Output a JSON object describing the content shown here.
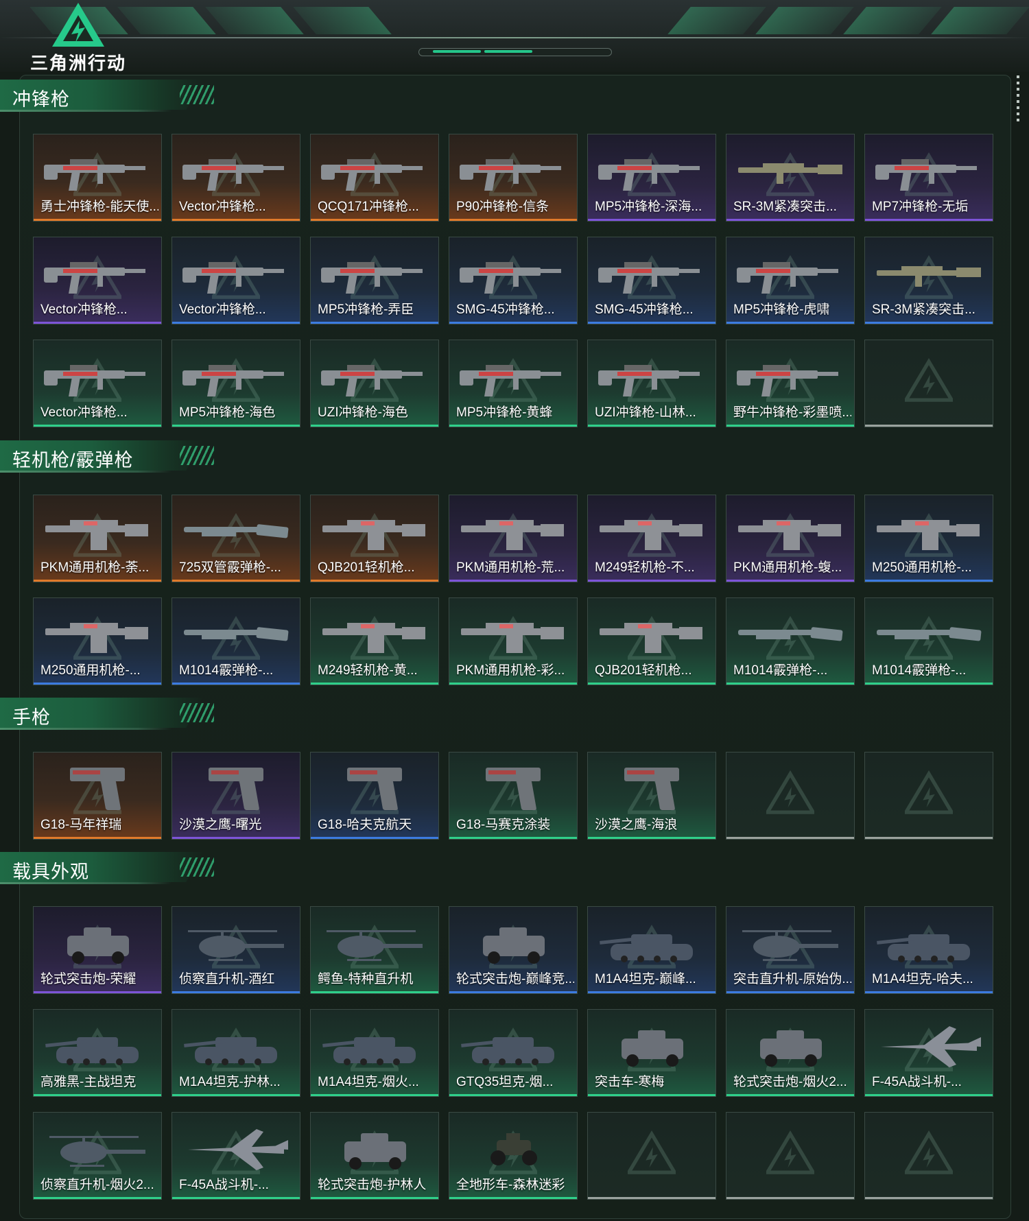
{
  "header": {
    "logo_text": "三角洲行动",
    "accent_color": "#2fd08a"
  },
  "rarity_colors": {
    "orange": "#e07a2a",
    "purple": "#7d54d8",
    "blue": "#3c7be0",
    "green": "#2fd08a",
    "empty": "#9aa29e"
  },
  "sections": [
    {
      "title": "冲锋枪",
      "items": [
        {
          "label": "勇士冲锋枪-能天使...",
          "rarity": "orange",
          "icon": "smg-icon"
        },
        {
          "label": "Vector冲锋枪...",
          "rarity": "orange",
          "icon": "smg-icon"
        },
        {
          "label": "QCQ171冲锋枪...",
          "rarity": "orange",
          "icon": "smg-icon"
        },
        {
          "label": "P90冲锋枪-信条",
          "rarity": "orange",
          "icon": "smg-icon"
        },
        {
          "label": "MP5冲锋枪-深海...",
          "rarity": "purple",
          "icon": "smg-icon"
        },
        {
          "label": "SR-3M紧凑突击...",
          "rarity": "purple",
          "icon": "rifle-icon"
        },
        {
          "label": "MP7冲锋枪-无垢",
          "rarity": "purple",
          "icon": "smg-icon"
        },
        {
          "label": "Vector冲锋枪...",
          "rarity": "purple",
          "icon": "smg-icon"
        },
        {
          "label": "Vector冲锋枪...",
          "rarity": "blue",
          "icon": "smg-icon"
        },
        {
          "label": "MP5冲锋枪-弄臣",
          "rarity": "blue",
          "icon": "smg-icon"
        },
        {
          "label": "SMG-45冲锋枪...",
          "rarity": "blue",
          "icon": "smg-icon"
        },
        {
          "label": "SMG-45冲锋枪...",
          "rarity": "blue",
          "icon": "smg-icon"
        },
        {
          "label": "MP5冲锋枪-虎啸",
          "rarity": "blue",
          "icon": "smg-icon"
        },
        {
          "label": "SR-3M紧凑突击...",
          "rarity": "blue",
          "icon": "rifle-icon"
        },
        {
          "label": "Vector冲锋枪...",
          "rarity": "green",
          "icon": "smg-icon"
        },
        {
          "label": "MP5冲锋枪-海色",
          "rarity": "green",
          "icon": "smg-icon"
        },
        {
          "label": "UZI冲锋枪-海色",
          "rarity": "green",
          "icon": "smg-icon"
        },
        {
          "label": "MP5冲锋枪-黄蜂",
          "rarity": "green",
          "icon": "smg-icon"
        },
        {
          "label": "UZI冲锋枪-山林...",
          "rarity": "green",
          "icon": "smg-icon"
        },
        {
          "label": "野牛冲锋枪-彩墨喷...",
          "rarity": "green",
          "icon": "smg-icon"
        },
        {
          "label": "",
          "rarity": "empty",
          "icon": ""
        }
      ]
    },
    {
      "title": "轻机枪/霰弹枪",
      "items": [
        {
          "label": "PKM通用机枪-荼...",
          "rarity": "orange",
          "icon": "lmg-icon"
        },
        {
          "label": "725双管霰弹枪-...",
          "rarity": "orange",
          "icon": "shotgun-icon"
        },
        {
          "label": "QJB201轻机枪...",
          "rarity": "orange",
          "icon": "lmg-icon"
        },
        {
          "label": "PKM通用机枪-荒...",
          "rarity": "purple",
          "icon": "lmg-icon"
        },
        {
          "label": "M249轻机枪-不...",
          "rarity": "purple",
          "icon": "lmg-icon"
        },
        {
          "label": "PKM通用机枪-蝮...",
          "rarity": "purple",
          "icon": "lmg-icon"
        },
        {
          "label": "M250通用机枪-...",
          "rarity": "blue",
          "icon": "lmg-icon"
        },
        {
          "label": "M250通用机枪-...",
          "rarity": "blue",
          "icon": "lmg-icon"
        },
        {
          "label": "M1014霰弹枪-...",
          "rarity": "blue",
          "icon": "shotgun-icon"
        },
        {
          "label": "M249轻机枪-黄...",
          "rarity": "green",
          "icon": "lmg-icon"
        },
        {
          "label": "PKM通用机枪-彩...",
          "rarity": "green",
          "icon": "lmg-icon"
        },
        {
          "label": "QJB201轻机枪...",
          "rarity": "green",
          "icon": "lmg-icon"
        },
        {
          "label": "M1014霰弹枪-...",
          "rarity": "green",
          "icon": "shotgun-icon"
        },
        {
          "label": "M1014霰弹枪-...",
          "rarity": "green",
          "icon": "shotgun-icon"
        }
      ]
    },
    {
      "title": "手枪",
      "items": [
        {
          "label": "G18-马年祥瑞",
          "rarity": "orange",
          "icon": "pistol-icon"
        },
        {
          "label": "沙漠之鹰-曙光",
          "rarity": "purple",
          "icon": "pistol-icon"
        },
        {
          "label": "G18-哈夫克航天",
          "rarity": "blue",
          "icon": "pistol-icon"
        },
        {
          "label": "G18-马赛克涂装",
          "rarity": "green",
          "icon": "pistol-icon"
        },
        {
          "label": "沙漠之鹰-海浪",
          "rarity": "green",
          "icon": "pistol-icon"
        },
        {
          "label": "",
          "rarity": "empty",
          "icon": ""
        },
        {
          "label": "",
          "rarity": "empty",
          "icon": ""
        }
      ]
    },
    {
      "title": "载具外观",
      "items": [
        {
          "label": "轮式突击炮-荣耀",
          "rarity": "purple",
          "icon": "armored-car-icon"
        },
        {
          "label": "侦察直升机-酒红",
          "rarity": "blue",
          "icon": "helicopter-icon"
        },
        {
          "label": "鳄鱼-特种直升机",
          "rarity": "green",
          "icon": "helicopter-icon"
        },
        {
          "label": "轮式突击炮-巅峰竞...",
          "rarity": "blue",
          "icon": "armored-car-icon"
        },
        {
          "label": "M1A4坦克-巅峰...",
          "rarity": "blue",
          "icon": "tank-icon"
        },
        {
          "label": "突击直升机-原始伪...",
          "rarity": "blue",
          "icon": "helicopter-icon"
        },
        {
          "label": "M1A4坦克-哈夫...",
          "rarity": "blue",
          "icon": "tank-icon"
        },
        {
          "label": "高雅黑-主战坦克",
          "rarity": "green",
          "icon": "tank-icon"
        },
        {
          "label": "M1A4坦克-护林...",
          "rarity": "green",
          "icon": "tank-icon"
        },
        {
          "label": "M1A4坦克-烟火...",
          "rarity": "green",
          "icon": "tank-icon"
        },
        {
          "label": "GTQ35坦克-烟...",
          "rarity": "green",
          "icon": "tank-icon"
        },
        {
          "label": "突击车-寒梅",
          "rarity": "green",
          "icon": "armored-car-icon"
        },
        {
          "label": "轮式突击炮-烟火2...",
          "rarity": "green",
          "icon": "armored-car-icon"
        },
        {
          "label": "F-45A战斗机-...",
          "rarity": "green",
          "icon": "jet-icon"
        },
        {
          "label": "侦察直升机-烟火2...",
          "rarity": "green",
          "icon": "helicopter-icon"
        },
        {
          "label": "F-45A战斗机-...",
          "rarity": "green",
          "icon": "jet-icon"
        },
        {
          "label": "轮式突击炮-护林人",
          "rarity": "green",
          "icon": "armored-car-icon"
        },
        {
          "label": "全地形车-森林迷彩",
          "rarity": "green",
          "icon": "atv-icon"
        },
        {
          "label": "",
          "rarity": "empty",
          "icon": ""
        },
        {
          "label": "",
          "rarity": "empty",
          "icon": ""
        },
        {
          "label": "",
          "rarity": "empty",
          "icon": ""
        }
      ]
    }
  ]
}
